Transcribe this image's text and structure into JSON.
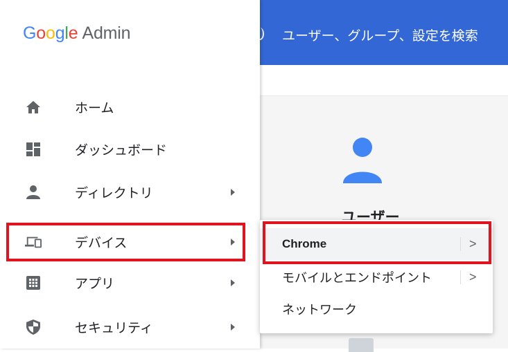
{
  "logo": {
    "brand": "Google",
    "product": "Admin"
  },
  "search": {
    "placeholder": "ユーザー、グループ、設定を検索"
  },
  "nav": {
    "items": [
      {
        "label": "ホーム",
        "icon": "home-icon"
      },
      {
        "label": "ダッシュボード",
        "icon": "dashboard-icon"
      },
      {
        "label": "ディレクトリ",
        "icon": "person-icon",
        "has_submenu": true
      },
      {
        "label": "デバイス",
        "icon": "devices-icon",
        "has_submenu": true,
        "highlighted": true
      },
      {
        "label": "アプリ",
        "icon": "apps-grid-icon",
        "has_submenu": true
      },
      {
        "label": "セキュリティ",
        "icon": "shield-icon",
        "has_submenu": true
      }
    ]
  },
  "submenu": {
    "items": [
      {
        "label": "Chrome",
        "selected": true,
        "has_submenu": true,
        "highlighted": true
      },
      {
        "label": "モバイルとエンドポイント",
        "has_submenu": true
      },
      {
        "label": "ネットワーク"
      }
    ],
    "chevron": ">"
  },
  "main": {
    "card_title": "ユーザー"
  },
  "colors": {
    "topbar": "#3367d6",
    "highlight": "#e0141e",
    "user_icon": "#4285f4",
    "google_blue": "#4285F4",
    "google_red": "#EA4335",
    "google_yellow": "#FBBC05",
    "google_green": "#34A853"
  }
}
